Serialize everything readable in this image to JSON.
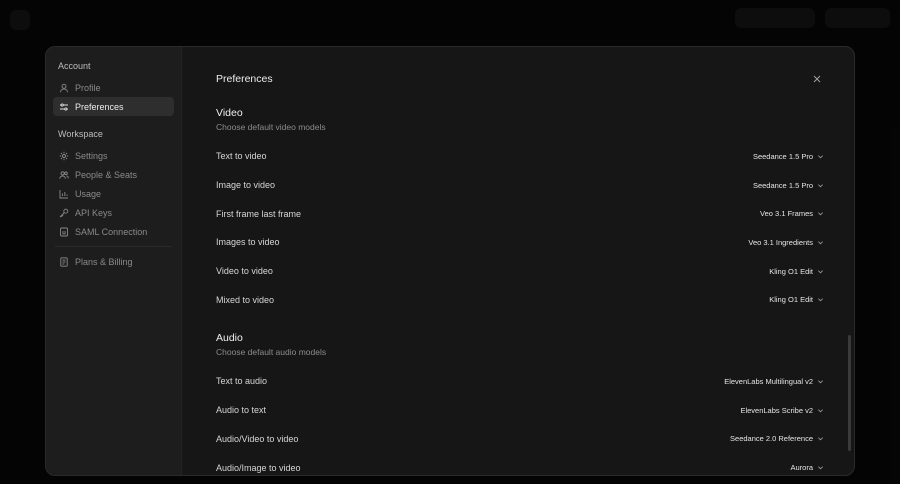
{
  "sidebar": {
    "account_label": "Account",
    "workspace_label": "Workspace",
    "items": [
      {
        "label": "Profile",
        "icon": "user-icon"
      },
      {
        "label": "Preferences",
        "icon": "sliders-icon"
      },
      {
        "label": "Settings",
        "icon": "gear-icon"
      },
      {
        "label": "People & Seats",
        "icon": "people-icon"
      },
      {
        "label": "Usage",
        "icon": "bar-chart-icon"
      },
      {
        "label": "API Keys",
        "icon": "key-icon"
      },
      {
        "label": "SAML Connection",
        "icon": "document-icon"
      },
      {
        "label": "Plans & Billing",
        "icon": "receipt-icon"
      }
    ]
  },
  "content": {
    "title": "Preferences",
    "video": {
      "title": "Video",
      "subtitle": "Choose default video models",
      "rows": [
        {
          "label": "Text to video",
          "value": "Seedance 1.5 Pro"
        },
        {
          "label": "Image to video",
          "value": "Seedance 1.5 Pro"
        },
        {
          "label": "First frame last frame",
          "value": "Veo 3.1 Frames"
        },
        {
          "label": "Images to video",
          "value": "Veo 3.1 Ingredients"
        },
        {
          "label": "Video to video",
          "value": "Kling O1 Edit"
        },
        {
          "label": "Mixed to video",
          "value": "Kling O1 Edit"
        }
      ]
    },
    "audio": {
      "title": "Audio",
      "subtitle": "Choose default audio models",
      "rows": [
        {
          "label": "Text to audio",
          "value": "ElevenLabs Multilingual v2"
        },
        {
          "label": "Audio to text",
          "value": "ElevenLabs Scribe v2"
        },
        {
          "label": "Audio/Video to video",
          "value": "Seedance 2.0 Reference"
        },
        {
          "label": "Audio/Image to video",
          "value": "Aurora"
        }
      ]
    }
  },
  "colors": {
    "modal_bg": "#161616",
    "sidebar_bg": "#1d1d1d",
    "active_item_bg": "#2e2e2e"
  }
}
